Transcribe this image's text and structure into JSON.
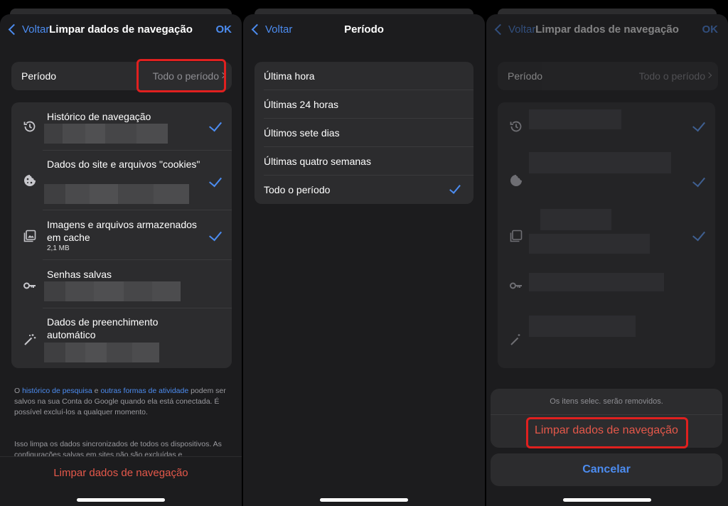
{
  "panel1": {
    "nav": {
      "back": "Voltar",
      "title": "Limpar dados de navegação",
      "ok": "OK"
    },
    "period": {
      "label": "Período",
      "value": "Todo o período"
    },
    "items": [
      {
        "title": "Histórico de navegação",
        "checked": true,
        "icon": "history-icon"
      },
      {
        "title": "Dados do site e arquivos \"cookies\"",
        "checked": true,
        "icon": "cookie-icon"
      },
      {
        "title": "Imagens e arquivos armazenados em cache",
        "subtitle": "2,1 MB",
        "checked": true,
        "icon": "image-icon"
      },
      {
        "title": "Senhas salvas",
        "checked": false,
        "icon": "key-icon"
      },
      {
        "title": "Dados de preenchimento automático",
        "checked": false,
        "icon": "magic-wand-icon"
      }
    ],
    "footnote1": {
      "pre": "O ",
      "link1": "histórico de pesquisa",
      "mid": " e ",
      "link2": "outras formas de atividade",
      "post": " podem ser salvos na sua Conta do Google quando ela está conectada. É possível excluí-los a qualquer momento."
    },
    "footnote2": "Isso limpa os dados sincronizados de todos os dispositivos. As configurações salvas em sites não são excluídas e",
    "clear_button": "Limpar dados de navegação"
  },
  "panel2": {
    "nav": {
      "back": "Voltar",
      "title": "Período"
    },
    "options": [
      {
        "label": "Última hora",
        "selected": false
      },
      {
        "label": "Últimas 24 horas",
        "selected": false
      },
      {
        "label": "Últimos sete dias",
        "selected": false
      },
      {
        "label": "Últimas quatro semanas",
        "selected": false
      },
      {
        "label": "Todo o período",
        "selected": true
      }
    ]
  },
  "panel3": {
    "nav": {
      "back": "Voltar",
      "title": "Limpar dados de navegação",
      "ok": "OK"
    },
    "period": {
      "label": "Período",
      "value": "Todo o período"
    },
    "sheet": {
      "message": "Os itens selec. serão removidos.",
      "action": "Limpar dados de navegação",
      "cancel": "Cancelar"
    }
  },
  "colors": {
    "accent": "#4c8cf0",
    "destructive": "#e5584a",
    "highlight": "#e0201f"
  }
}
